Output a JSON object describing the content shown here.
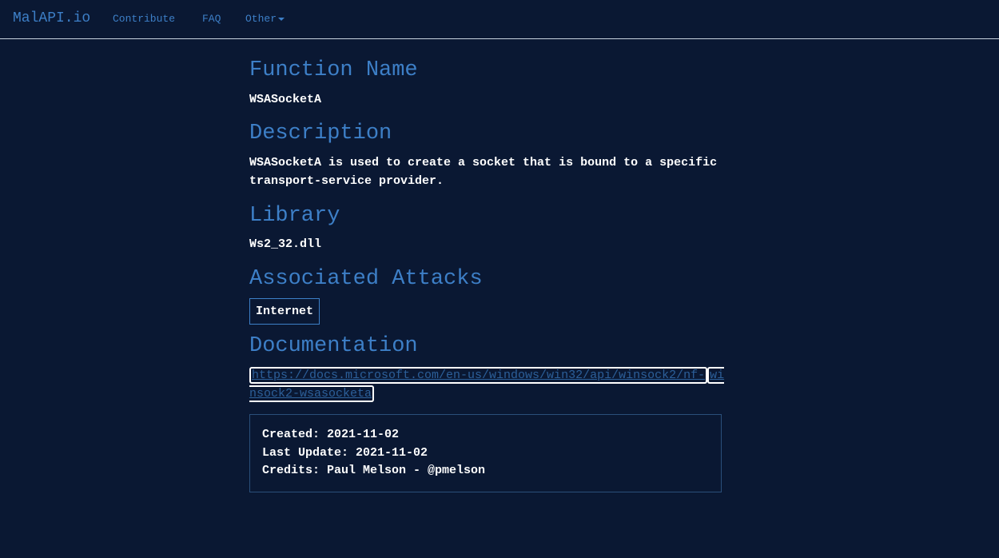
{
  "nav": {
    "brand": "MalAPI.io",
    "links": [
      {
        "label": "Contribute"
      },
      {
        "label": "FAQ"
      },
      {
        "label": "Other"
      }
    ]
  },
  "sections": {
    "function_name": {
      "heading": "Function Name",
      "value": "WSASocketA"
    },
    "description": {
      "heading": "Description",
      "value": "WSASocketA is used to create a socket that is bound to a specific transport-service provider."
    },
    "library": {
      "heading": "Library",
      "value": "Ws2_32.dll"
    },
    "attacks": {
      "heading": "Associated Attacks",
      "tags": [
        "Internet"
      ]
    },
    "documentation": {
      "heading": "Documentation",
      "link_part1": "https://docs.microsoft.com/en-us/windows/win32/api/winsock2/nf-",
      "link_part2": "winsock2-wsasocketa"
    }
  },
  "meta": {
    "created": "Created: 2021-11-02",
    "last_update": "Last Update: 2021-11-02",
    "credits": "Credits: Paul Melson - @pmelson"
  },
  "colors": {
    "background": "#0a1833",
    "accent": "#3d7fc7",
    "link": "#2c5f99",
    "text": "#ffffff"
  }
}
